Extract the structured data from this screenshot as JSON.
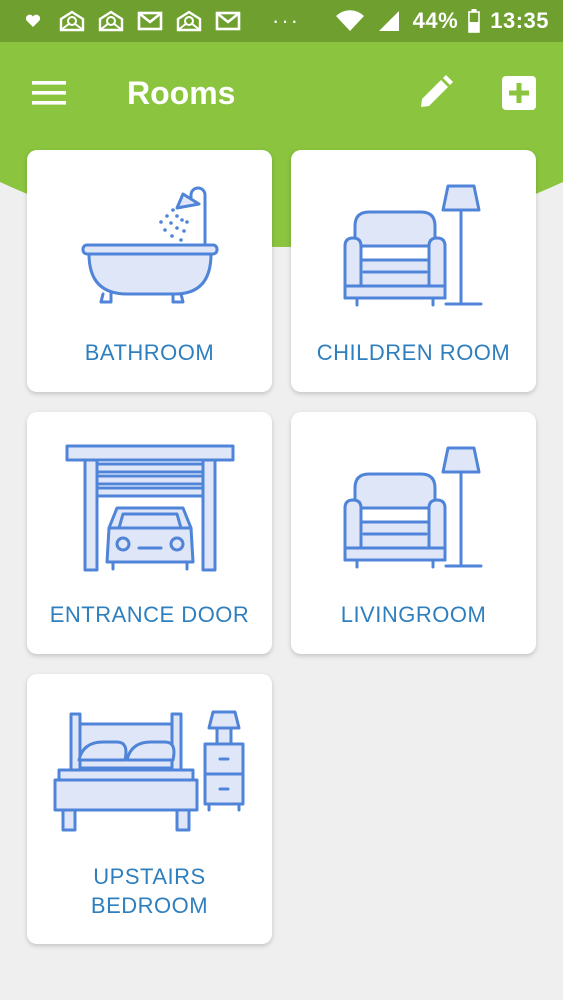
{
  "status_bar": {
    "battery_percent": "44%",
    "time": "13:35",
    "overflow": "···"
  },
  "app_bar": {
    "title": "Rooms"
  },
  "rooms": [
    {
      "label": "BATHROOM",
      "icon": "bathtub-icon"
    },
    {
      "label": "CHILDREN ROOM",
      "icon": "armchair-lamp-icon"
    },
    {
      "label": "ENTRANCE DOOR",
      "icon": "garage-car-icon"
    },
    {
      "label": "LIVINGROOM",
      "icon": "armchair-lamp-icon"
    },
    {
      "label": "UPSTAIRS BEDROOM",
      "label_line1": "UPSTAIRS",
      "label_line2": "BEDROOM",
      "icon": "bed-nightstand-icon"
    }
  ],
  "colors": {
    "green": "#8bc43f",
    "status_green": "#6f9f2f",
    "icon_stroke": "#4f84d8",
    "icon_fill": "#dfe6f7",
    "label_blue": "#2f7fbe",
    "background": "#efefef"
  }
}
